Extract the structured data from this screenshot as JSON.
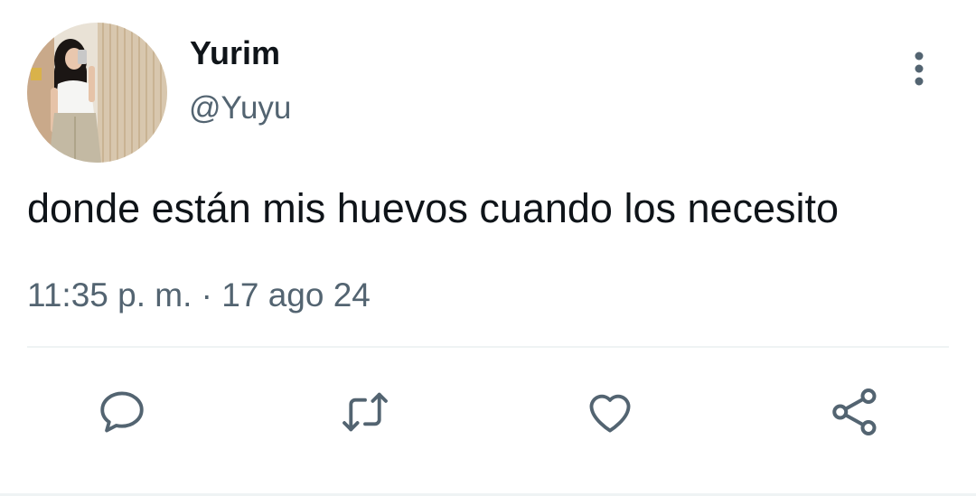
{
  "user": {
    "display_name": "Yurim",
    "handle": "@Yuyu"
  },
  "tweet": {
    "text": "donde están mis huevos cuando los necesito",
    "time": "11:35 p. m.",
    "separator": "·",
    "date": "17 ago 24"
  },
  "actions": [
    {
      "icon": "reply-icon"
    },
    {
      "icon": "retweet-icon"
    },
    {
      "icon": "like-icon"
    },
    {
      "icon": "share-icon"
    }
  ],
  "colors": {
    "text_primary": "#0f1419",
    "text_secondary": "#536471",
    "divider": "#eff3f4"
  }
}
